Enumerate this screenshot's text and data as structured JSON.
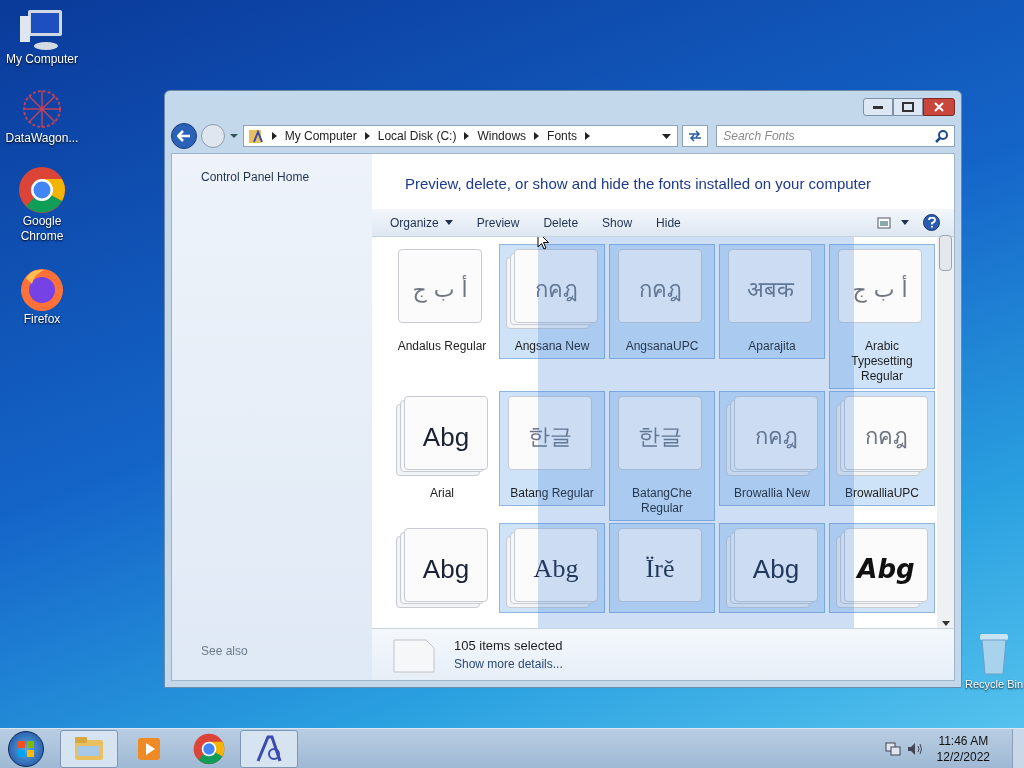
{
  "desktop_icons": [
    {
      "label": "My Computer",
      "kind": "computer"
    },
    {
      "label": "DataWagon...",
      "kind": "datawagon"
    },
    {
      "label": "Google Chrome",
      "kind": "chrome"
    },
    {
      "label": "Firefox",
      "kind": "firefox"
    }
  ],
  "recycle_bin": {
    "label": "Recycle Bin"
  },
  "window": {
    "breadcrumb": [
      "My Computer",
      "Local Disk (C:)",
      "Windows",
      "Fonts"
    ],
    "search": {
      "placeholder": "Search Fonts"
    },
    "sidebar": {
      "link": "Control Panel Home",
      "see_also": "See also"
    },
    "heading": "Preview, delete, or show and hide the fonts installed on your computer",
    "toolbar": [
      {
        "label": "Organize",
        "dropdown": true
      },
      {
        "label": "Preview",
        "dropdown": false
      },
      {
        "label": "Delete",
        "dropdown": false
      },
      {
        "label": "Show",
        "dropdown": false
      },
      {
        "label": "Hide",
        "dropdown": false
      }
    ],
    "fonts": [
      {
        "name": "Andalus Regular",
        "preview": "أ ب ج",
        "kind": "script",
        "stacked": false,
        "selected": false
      },
      {
        "name": "Angsana New",
        "preview": "กคฎ",
        "kind": "script",
        "stacked": true,
        "selected": true
      },
      {
        "name": "AngsanaUPC",
        "preview": "กคฎ",
        "kind": "script",
        "stacked": false,
        "selected": true
      },
      {
        "name": "Aparajita",
        "preview": "अबक",
        "kind": "script",
        "stacked": false,
        "selected": true
      },
      {
        "name": "Arabic Typesetting Regular",
        "preview": "أ ب ج",
        "kind": "script",
        "stacked": false,
        "selected": true
      },
      {
        "name": "Arial",
        "preview": "Abg",
        "kind": "sample",
        "stacked": true,
        "selected": false
      },
      {
        "name": "Batang Regular",
        "preview": "한글",
        "kind": "script",
        "stacked": false,
        "selected": true
      },
      {
        "name": "BatangChe Regular",
        "preview": "한글",
        "kind": "script",
        "stacked": false,
        "selected": true
      },
      {
        "name": "Browallia New",
        "preview": "กคฎ",
        "kind": "script",
        "stacked": true,
        "selected": true
      },
      {
        "name": "BrowalliaUPC",
        "preview": "กคฎ",
        "kind": "script",
        "stacked": true,
        "selected": true
      },
      {
        "preview": "Abg",
        "kind": "sample",
        "stacked": true,
        "selected": false
      },
      {
        "preview": "Abg",
        "kind": "serif",
        "stacked": true,
        "selected": true
      },
      {
        "preview": "Ïrě",
        "kind": "serif",
        "stacked": false,
        "selected": true
      },
      {
        "preview": "Abg",
        "kind": "sample",
        "stacked": true,
        "selected": true
      },
      {
        "preview": "Abg",
        "kind": "bold",
        "stacked": true,
        "selected": true
      }
    ],
    "details": {
      "summary": "105 items selected",
      "link": "Show more details..."
    }
  },
  "taskbar": {
    "apps": [
      {
        "kind": "explorer",
        "selected": true
      },
      {
        "kind": "media",
        "selected": false
      },
      {
        "kind": "chrome",
        "selected": false
      },
      {
        "kind": "fonts",
        "selected": true
      }
    ],
    "clock": {
      "time": "11:46 AM",
      "date": "12/2/2022"
    }
  }
}
